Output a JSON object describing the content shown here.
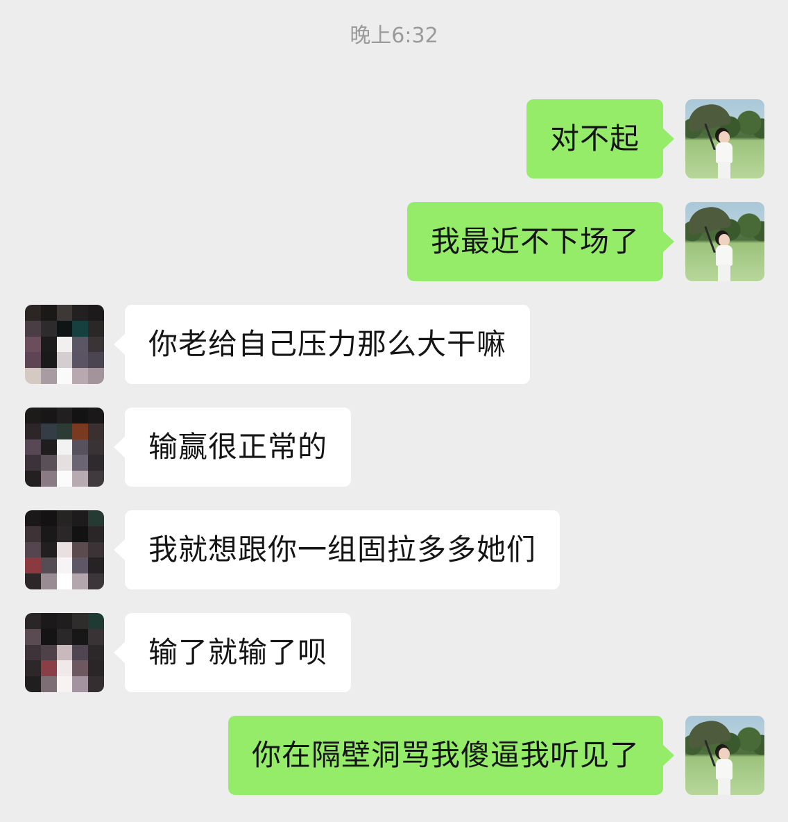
{
  "timestamp": "晚上6:32",
  "messages": [
    {
      "side": "self",
      "text": "对不起"
    },
    {
      "side": "self",
      "text": "我最近不下场了"
    },
    {
      "side": "other",
      "text": "你老给自己压力那么大干嘛"
    },
    {
      "side": "other",
      "text": "输赢很正常的"
    },
    {
      "side": "other",
      "text": "我就想跟你一组固拉多多她们"
    },
    {
      "side": "other",
      "text": "输了就输了呗"
    },
    {
      "side": "self",
      "text": "你在隔壁洞骂我傻逼我听见了"
    }
  ],
  "avatars": {
    "self": "golfer-with-umbrella",
    "other": "pixelated-mosaic"
  },
  "colors": {
    "background": "#ededed",
    "self_bubble": "#95ec69",
    "other_bubble": "#ffffff",
    "timestamp_text": "#9a9a9a"
  }
}
